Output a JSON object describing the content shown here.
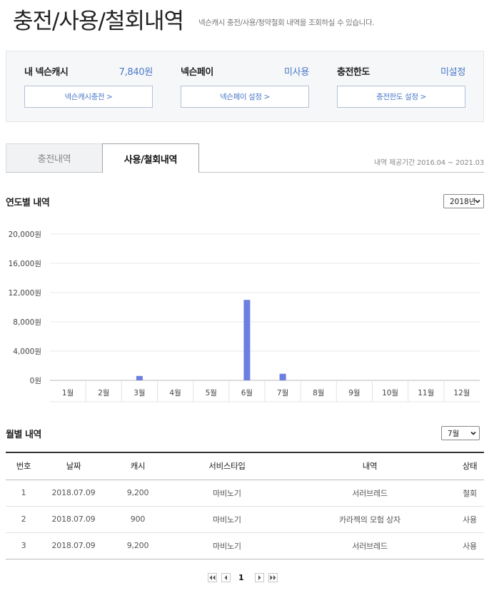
{
  "page": {
    "title": "충전/사용/철회내역",
    "subtitle": "넥슨캐시 충전/사용/청약철회 내역을 조회하실 수 있습니다."
  },
  "summary": {
    "cash": {
      "label": "내 넥슨캐시",
      "value": "7,840원",
      "button": "넥슨캐시충전 >"
    },
    "pay": {
      "label": "넥슨페이",
      "value": "미사용",
      "button": "넥슨페이 설정 >"
    },
    "limit": {
      "label": "충전한도",
      "value": "미설정",
      "button": "충전한도 설정 >"
    }
  },
  "tabs": {
    "charge": "충전내역",
    "use": "사용/철회내역",
    "active": "use"
  },
  "period": "내역 제공기간 2016.04 ~ 2021.03",
  "yearly": {
    "title": "연도별 내역",
    "selected_year": "2018년"
  },
  "chart_data": {
    "type": "bar",
    "categories": [
      "1월",
      "2월",
      "3월",
      "4월",
      "5월",
      "6월",
      "7월",
      "8월",
      "9월",
      "10월",
      "11월",
      "12월"
    ],
    "values": [
      0,
      0,
      600,
      0,
      0,
      11000,
      900,
      0,
      0,
      0,
      0,
      0
    ],
    "yticks": [
      "0원",
      "4,000원",
      "8,000원",
      "12,000원",
      "16,000원",
      "20,000원"
    ],
    "ytick_values": [
      0,
      4000,
      8000,
      12000,
      16000,
      20000
    ],
    "ylim": [
      0,
      20000
    ],
    "bar_color": "#6b7fe0",
    "grid": true
  },
  "monthly": {
    "title": "월별 내역",
    "selected_month": "7월",
    "columns": [
      "번호",
      "날짜",
      "캐시",
      "서비스타입",
      "내역",
      "상태"
    ],
    "rows": [
      [
        "1",
        "2018.07.09",
        "9,200",
        "마비노기",
        "서러브레드",
        "철회"
      ],
      [
        "2",
        "2018.07.09",
        "900",
        "마비노기",
        "카라젝의 모험 상자",
        "사용"
      ],
      [
        "3",
        "2018.07.09",
        "9,200",
        "마비노기",
        "서러브레드",
        "사용"
      ]
    ]
  },
  "pagination": {
    "current": "1"
  },
  "colors": {
    "accent": "#4a78c8",
    "bar": "#6b7fe0"
  }
}
